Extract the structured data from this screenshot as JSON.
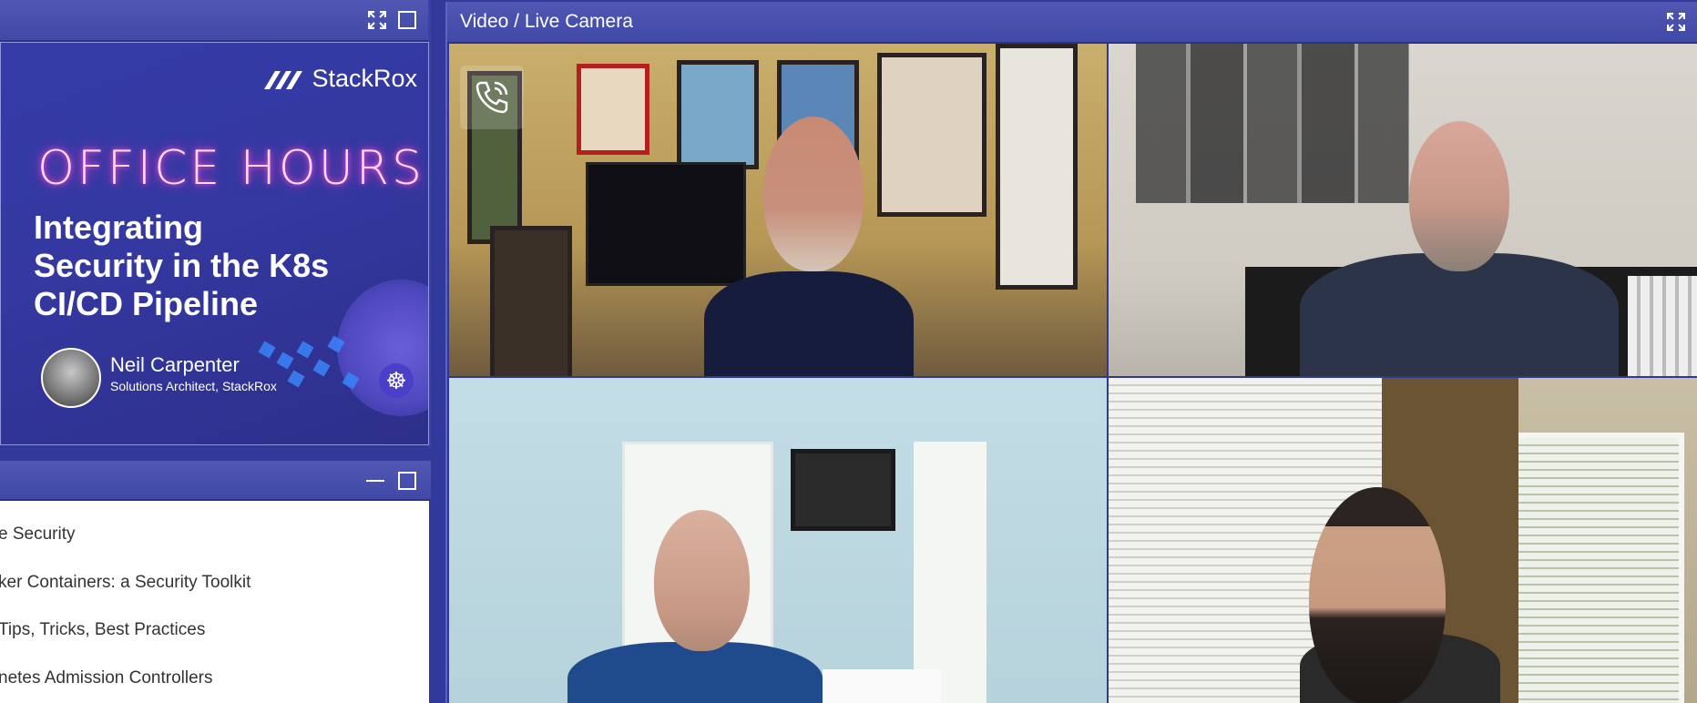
{
  "slide_panel": {
    "window_controls": {
      "expand": "expand-icon",
      "maximize": "maximize-icon"
    },
    "slide": {
      "brand": "StackRox",
      "heading": "OFFICE HOURS",
      "talk_title": "Integrating Security in the K8s CI/CD Pipeline",
      "speaker_name": "Neil Carpenter",
      "speaker_role": "Solutions Architect, StackRox"
    }
  },
  "list_panel": {
    "window_controls": {
      "minimize": "minimize-icon",
      "maximize": "maximize-icon"
    },
    "items": [
      {
        "label": "e Security"
      },
      {
        "label": "ker Containers: a Security Toolkit"
      },
      {
        "label": "Tips, Tricks, Best Practices"
      },
      {
        "label": "netes Admission Controllers"
      }
    ]
  },
  "video_panel": {
    "title": "Video / Live Camera",
    "window_controls": {
      "expand": "expand-icon"
    },
    "call_icon": "phone-call-icon",
    "participants": [
      {
        "name": "participant-1"
      },
      {
        "name": "participant-2"
      },
      {
        "name": "participant-3"
      },
      {
        "name": "participant-4"
      }
    ]
  }
}
